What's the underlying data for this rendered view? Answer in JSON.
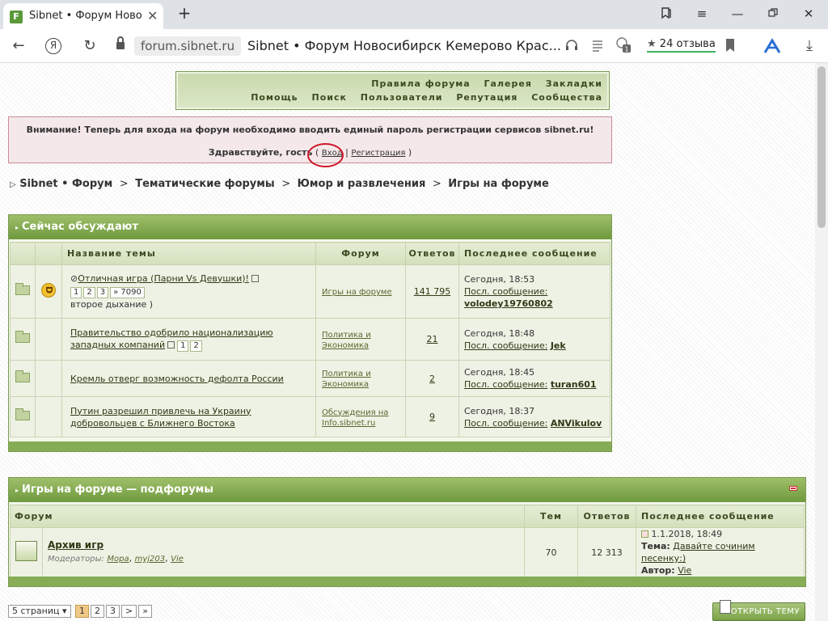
{
  "browser": {
    "tab_title": "Sibnet • Форум Новоси",
    "tab_favicon": "F",
    "new_tab": "+",
    "close_tab": "✕",
    "domain": "forum.sibnet.ru",
    "page_title": "Sibnet • Форум Новосибирск Кемерово Крас...",
    "reviews": "24 отзыва",
    "yandex_letter": "Я",
    "extension_badge": "1"
  },
  "topnav": {
    "row1": [
      "Правила форума",
      "Галерея",
      "Закладки"
    ],
    "row2": [
      "Помощь",
      "Поиск",
      "Пользователи",
      "Репутация",
      "Сообщества"
    ]
  },
  "notice": {
    "line1": "Внимание! Теперь для входа на форум необходимо вводить единый пароль регистрации сервисов sibnet.ru!",
    "greeting": "Здравствуйте, гость",
    "open_paren": "(",
    "login": "Вход",
    "separator": "|",
    "register": "Регистрация",
    "close_paren": ")"
  },
  "breadcrumb": {
    "items": [
      "Sibnet • Форум",
      "Тематические форумы",
      "Юмор и развлечения",
      "Игры на форуме"
    ],
    "sep": ">"
  },
  "hot": {
    "title": "Сейчас обсуждают",
    "headers": [
      "Название темы",
      "Форум",
      "Ответов",
      "Последнее сообщение"
    ],
    "last_prefix": "Посл. сообщение:",
    "rows": [
      {
        "title": "Отличная игра (Парни Vs Девушки)!",
        "pages": [
          "1",
          "2",
          "3",
          "» 7090"
        ],
        "subtitle": "второе дыхание )",
        "forum": "Игры на форуме",
        "replies": "141 795",
        "time": "Сегодня, 18:53",
        "user": "volodey19760802"
      },
      {
        "title": "Правительство одобрило национализацию западных компаний",
        "pages": [
          "1",
          "2"
        ],
        "subtitle": "",
        "forum": "Политика и Экономика",
        "replies": "21",
        "time": "Сегодня, 18:48",
        "user": "Jek"
      },
      {
        "title": "Кремль отверг возможность дефолта России",
        "pages": [],
        "subtitle": "",
        "forum": "Политика и Экономика",
        "replies": "2",
        "time": "Сегодня, 18:45",
        "user": "turan601"
      },
      {
        "title": "Путин разрешил привлечь на Украину добровольцев с Ближнего Востока",
        "pages": [],
        "subtitle": "",
        "forum": "Обсуждения на Info.sibnet.ru",
        "replies": "9",
        "time": "Сегодня, 18:37",
        "user": "ANVikulov"
      }
    ]
  },
  "subforums": {
    "title": "Игры на форуме — подфорумы",
    "headers": [
      "Форум",
      "Тем",
      "Ответов",
      "Последнее сообщение"
    ],
    "row": {
      "name": "Архив игр",
      "moderators_label": "Модераторы:",
      "moderators": [
        "Мора",
        "myj203",
        "Vie"
      ],
      "topics": "70",
      "replies": "12 313",
      "date": "1.1.2018, 18:49",
      "topic_label": "Тема:",
      "topic": "Давайте сочиним песенку:)",
      "author_label": "Автор:",
      "author": "Vie"
    }
  },
  "pager": {
    "label": "5 страниц",
    "pages": [
      "1",
      "2",
      "3",
      ">",
      "»"
    ],
    "current": "1"
  },
  "new_topic": "ОТКРЫТЬ ТЕМУ"
}
